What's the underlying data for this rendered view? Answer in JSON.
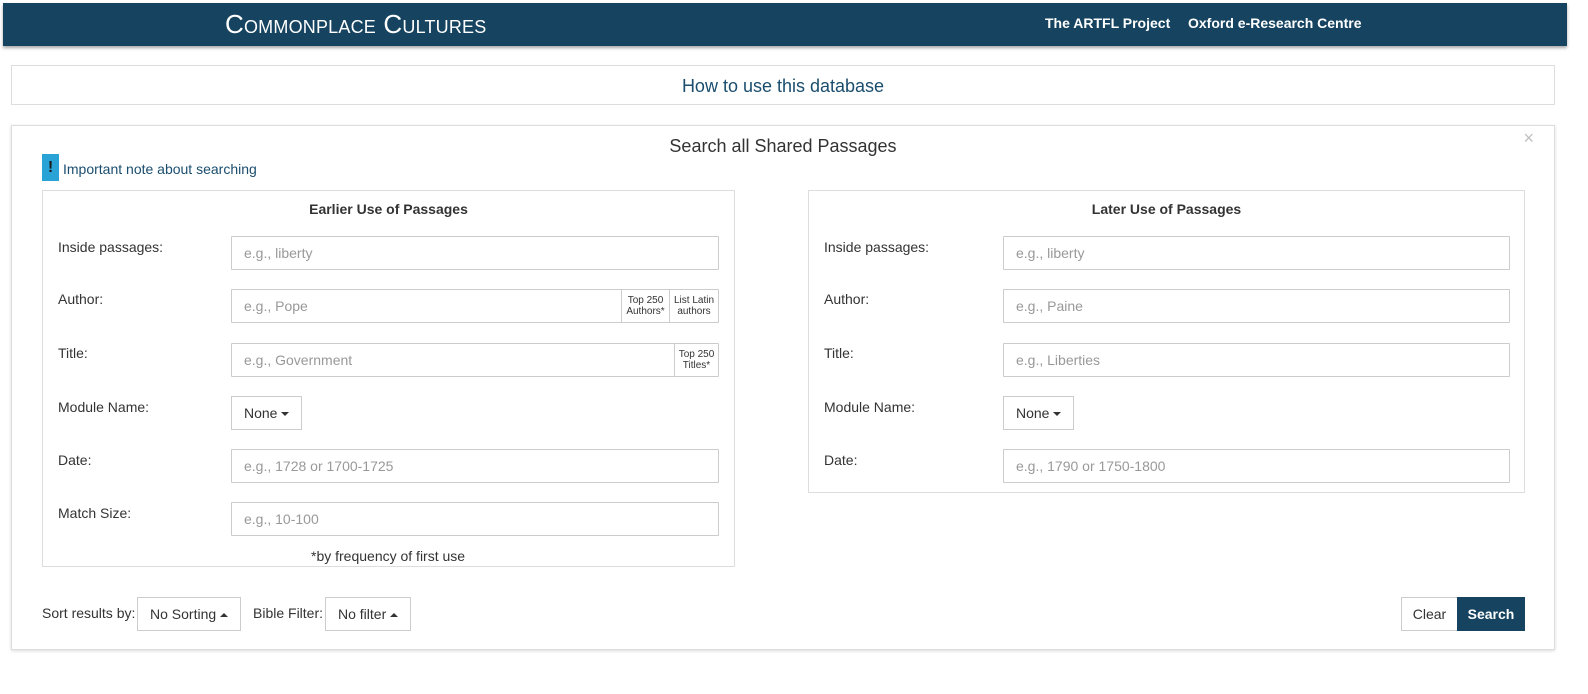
{
  "header": {
    "brand": "Commonplace Cultures",
    "links": [
      "The ARTFL Project",
      "Oxford e-Research Centre"
    ]
  },
  "howto": {
    "label": "How to use this database"
  },
  "panel": {
    "title": "Search all Shared Passages",
    "close": "×",
    "note_badge": "!",
    "note_link": "Important note about searching"
  },
  "earlier": {
    "title": "Earlier Use of Passages",
    "labels": {
      "inside": "Inside passages:",
      "author": "Author:",
      "title": "Title:",
      "module": "Module Name:",
      "date": "Date:",
      "match": "Match Size:"
    },
    "placeholders": {
      "inside": "e.g., liberty",
      "author": "e.g., Pope",
      "title": "e.g., Government",
      "date": "e.g., 1728 or 1700-1725",
      "match": "e.g., 10-100"
    },
    "addons": {
      "top_authors_1": "Top 250",
      "top_authors_2": "Authors*",
      "latin_1": "List Latin",
      "latin_2": "authors",
      "top_titles_1": "Top 250",
      "top_titles_2": "Titles*"
    },
    "module_value": "None",
    "footnote": "*by frequency of first use"
  },
  "later": {
    "title": "Later Use of Passages",
    "labels": {
      "inside": "Inside passages:",
      "author": "Author:",
      "title": "Title:",
      "module": "Module Name:",
      "date": "Date:"
    },
    "placeholders": {
      "inside": "e.g., liberty",
      "author": "e.g., Paine",
      "title": "e.g., Liberties",
      "date": "e.g., 1790 or 1750-1800"
    },
    "module_value": "None"
  },
  "footer": {
    "sort_label": "Sort results by:",
    "sort_value": "No Sorting",
    "bible_label": "Bible Filter:",
    "bible_value": "No filter",
    "clear": "Clear",
    "search": "Search"
  },
  "colors": {
    "navbar": "#154360",
    "link": "#1a4d6e",
    "badge": "#29a3d6"
  }
}
